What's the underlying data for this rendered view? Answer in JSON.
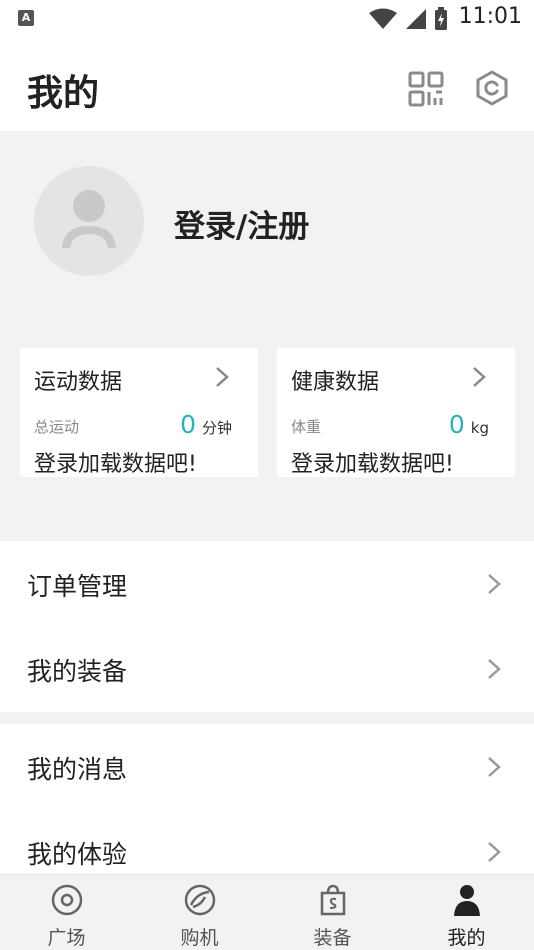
{
  "status_bar": {
    "app_badge": "A",
    "time": "11:01"
  },
  "header": {
    "title": "我的",
    "qr_icon": "qr-code-icon",
    "settings_icon": "settings-hex-icon"
  },
  "profile": {
    "login_label": "登录/注册",
    "avatar_icon": "user-avatar-icon"
  },
  "cards": {
    "sport": {
      "title": "运动数据",
      "metric_label": "总运动",
      "metric_value": "0",
      "metric_unit": "分钟",
      "hint": "登录加载数据吧!"
    },
    "health": {
      "title": "健康数据",
      "metric_label": "体重",
      "metric_value": "0",
      "metric_unit": "kg",
      "hint": "登录加载数据吧!"
    }
  },
  "menu": {
    "orders": "订单管理",
    "equipment": "我的装备",
    "messages": "我的消息",
    "experience": "我的体验"
  },
  "bottom_nav": {
    "plaza": "广场",
    "buy": "购机",
    "gear": "装备",
    "mine": "我的"
  },
  "colors": {
    "accent": "#2ab0c5",
    "background": "#f2f2f2",
    "card": "#ffffff"
  }
}
